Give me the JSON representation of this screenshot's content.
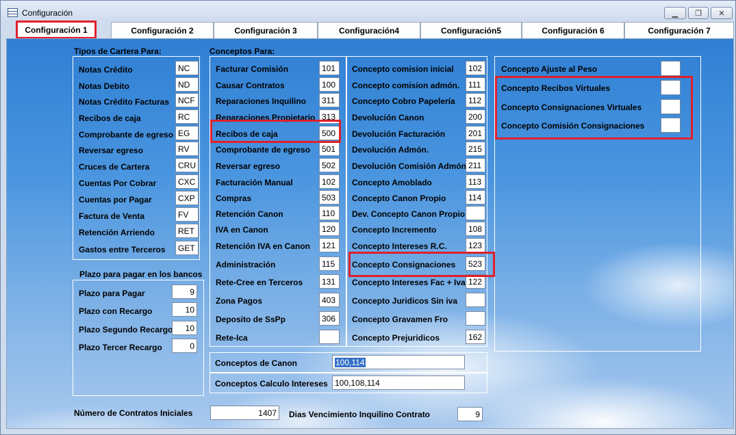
{
  "window": {
    "title": "Configuración"
  },
  "tabs": [
    "Configuración 1",
    "Configuración 2",
    "Configuración 3",
    "Configuración4",
    "Configuración5",
    "Configuración 6",
    "Configuración 7"
  ],
  "cartera": {
    "title": "Tipos de Cartera Para:",
    "items": [
      {
        "label": "Notas Crédito",
        "value": "NC"
      },
      {
        "label": "Notas Debito",
        "value": "ND"
      },
      {
        "label": "Notas Crédito Facturas",
        "value": "NCF"
      },
      {
        "label": "Recibos de caja",
        "value": "RC"
      },
      {
        "label": "Comprobante de egreso",
        "value": "EG"
      },
      {
        "label": "Reversar egreso",
        "value": "RV"
      },
      {
        "label": "Cruces de Cartera",
        "value": "CRU"
      },
      {
        "label": "Cuentas Por Cobrar",
        "value": "CXC"
      },
      {
        "label": "Cuentas por Pagar",
        "value": "CXP"
      },
      {
        "label": "Factura de Venta",
        "value": "FV"
      },
      {
        "label": "Retención Arriendo",
        "value": "RET"
      },
      {
        "label": "Gastos entre Terceros",
        "value": "GET"
      }
    ]
  },
  "plazo": {
    "title": "Plazo para pagar en los bancos",
    "items": [
      {
        "label": "Plazo para Pagar",
        "value": "9"
      },
      {
        "label": "Plazo con Recargo",
        "value": "10"
      },
      {
        "label": "Plazo Segundo Recargo",
        "value": "10"
      },
      {
        "label": "Plazo Tercer Recargo",
        "value": "0"
      }
    ]
  },
  "conceptos": {
    "title": "Conceptos Para:",
    "col1": [
      {
        "label": "Facturar Comisión",
        "value": "101"
      },
      {
        "label": "Causar Contratos",
        "value": "100"
      },
      {
        "label": "Reparaciones Inquilino",
        "value": "311"
      },
      {
        "label": "Reparaciones Propietario",
        "value": "313"
      },
      {
        "label": "Recibos de caja",
        "value": "500"
      },
      {
        "label": "Comprobante de egreso",
        "value": "501"
      },
      {
        "label": "Reversar egreso",
        "value": "502"
      },
      {
        "label": "Facturación Manual",
        "value": "102"
      },
      {
        "label": "Compras",
        "value": "503"
      },
      {
        "label": "Retención Canon",
        "value": "110"
      },
      {
        "label": "IVA en Canon",
        "value": "120"
      },
      {
        "label": "Retención IVA en Canon",
        "value": "121"
      },
      {
        "label": "Administración",
        "value": "115"
      },
      {
        "label": "Rete-Cree en Terceros",
        "value": "131"
      },
      {
        "label": "Zona Pagos",
        "value": "403"
      },
      {
        "label": "Deposito de SsPp",
        "value": "306"
      },
      {
        "label": "Rete-Ica",
        "value": ""
      }
    ],
    "col2": [
      {
        "label": "Concepto comision inicial",
        "value": "102"
      },
      {
        "label": "Concepto comision admón.",
        "value": "111"
      },
      {
        "label": "Concepto Cobro Papelería",
        "value": "112"
      },
      {
        "label": "Devolución Canon",
        "value": "200"
      },
      {
        "label": "Devolución Facturación",
        "value": "201"
      },
      {
        "label": "Devolución Admón.",
        "value": "215"
      },
      {
        "label": "Devolución Comisión Admón.",
        "value": "211"
      },
      {
        "label": "Concepto Amoblado",
        "value": "113"
      },
      {
        "label": "Concepto Canon Propio",
        "value": "114"
      },
      {
        "label": "Dev. Concepto Canon Propio",
        "value": ""
      },
      {
        "label": "Concepto Incremento",
        "value": "108"
      },
      {
        "label": "Concepto Intereses R.C.",
        "value": "123"
      },
      {
        "label": "Concepto Consignaciones",
        "value": "523"
      },
      {
        "label": "Concepto Intereses Fac + Iva",
        "value": "122"
      },
      {
        "label": "Concepto Juridicos Sin iva",
        "value": ""
      },
      {
        "label": "Concepto Gravamen Fro",
        "value": ""
      },
      {
        "label": "Concepto Prejuridicos",
        "value": "162"
      }
    ]
  },
  "right": [
    {
      "label": "Concepto Ajuste al Peso",
      "value": ""
    },
    {
      "label": "Concepto Recibos Virtuales",
      "value": ""
    },
    {
      "label": "Concepto Consignaciones Virtuales",
      "value": ""
    },
    {
      "label": "Concepto Comisión Consignaciones",
      "value": ""
    }
  ],
  "canon": {
    "label": "Conceptos de Canon",
    "value": "100,114"
  },
  "calculo": {
    "label": "Conceptos Calculo Intereses",
    "value": "100,108,114"
  },
  "contratos": {
    "label": "Número de Contratos Iniciales",
    "value": "1407"
  },
  "dias": {
    "label": "Dias Vencimiento Inquilino Contrato",
    "value": "9"
  },
  "highlight_color": "#e0202a"
}
